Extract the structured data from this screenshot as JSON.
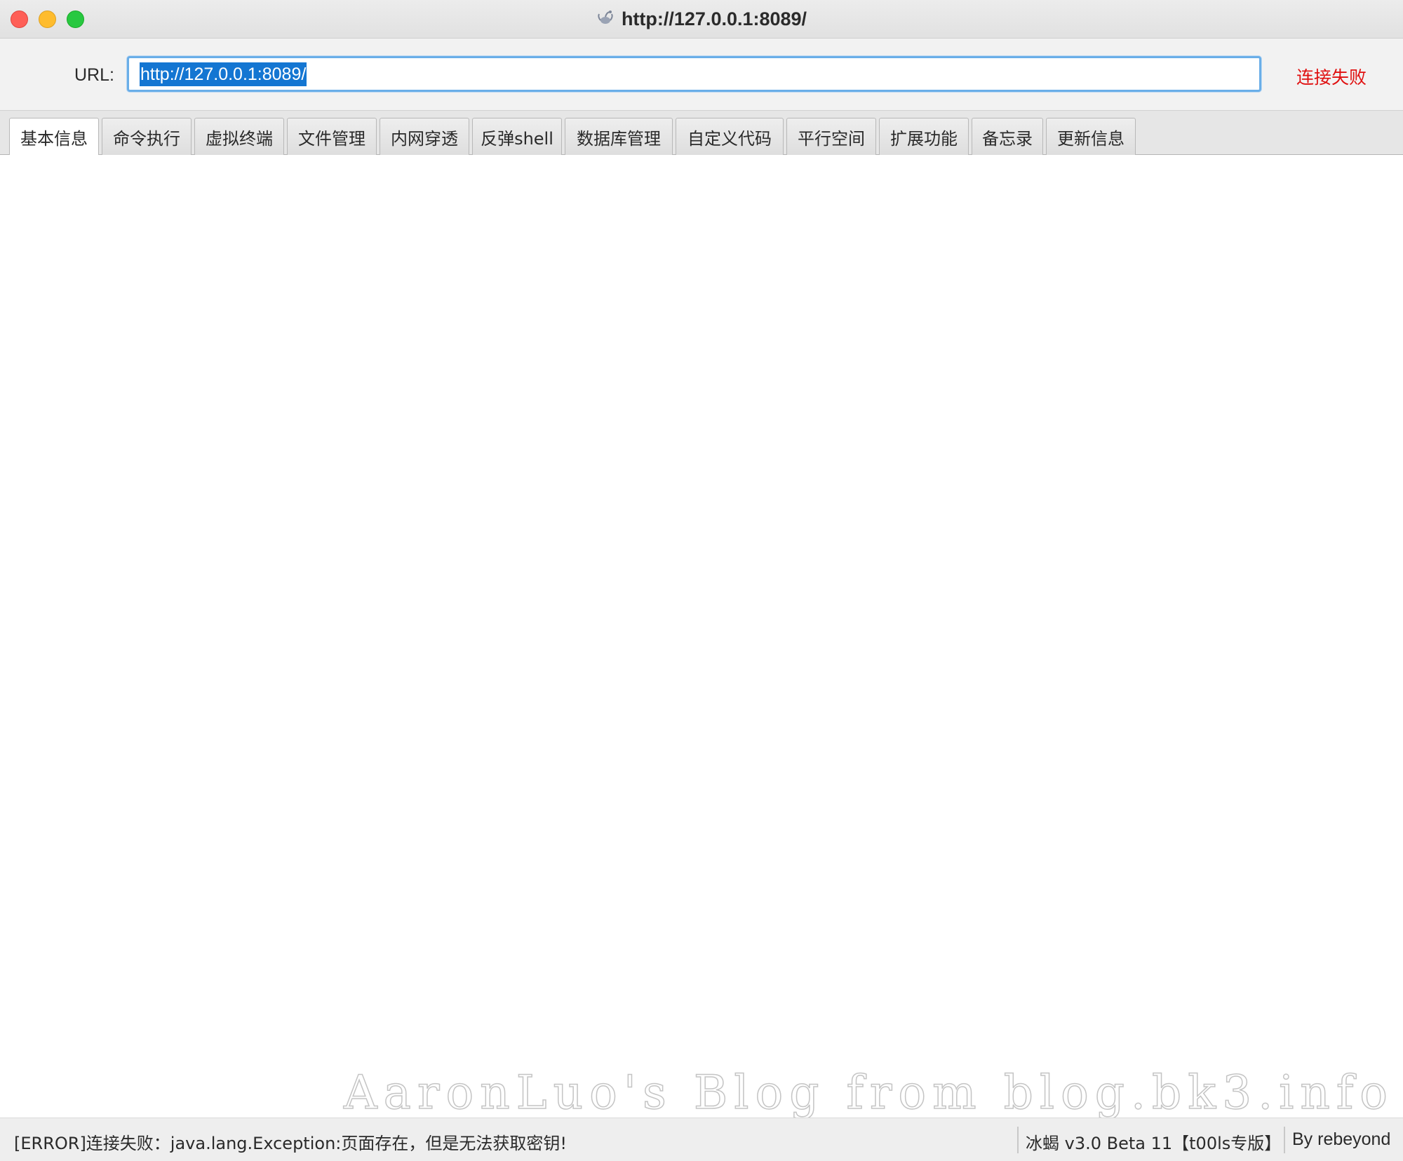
{
  "window": {
    "title": "http://127.0.0.1:8089/",
    "app_icon": "scorpion-icon"
  },
  "urlbar": {
    "label": "URL:",
    "value": "http://127.0.0.1:8089/",
    "connection_status": "连接失败",
    "connection_status_color": "#e01010",
    "selection_color": "#1476d2"
  },
  "tabs": [
    {
      "label": "基本信息",
      "active": true
    },
    {
      "label": "命令执行",
      "active": false
    },
    {
      "label": "虚拟终端",
      "active": false
    },
    {
      "label": "文件管理",
      "active": false
    },
    {
      "label": "内网穿透",
      "active": false
    },
    {
      "label": "反弹shell",
      "active": false
    },
    {
      "label": "数据库管理",
      "active": false
    },
    {
      "label": "自定义代码",
      "active": false
    },
    {
      "label": "平行空间",
      "active": false
    },
    {
      "label": "扩展功能",
      "active": false
    },
    {
      "label": "备忘录",
      "active": false
    },
    {
      "label": "更新信息",
      "active": false
    }
  ],
  "watermark": "AaronLuo's Blog from blog.bk3.info",
  "statusbar": {
    "message": "[ERROR]连接失败：java.lang.Exception:页面存在，但是无法获取密钥!",
    "version": "冰蝎 v3.0 Beta 11【t00ls专版】",
    "author": "By rebeyond"
  }
}
